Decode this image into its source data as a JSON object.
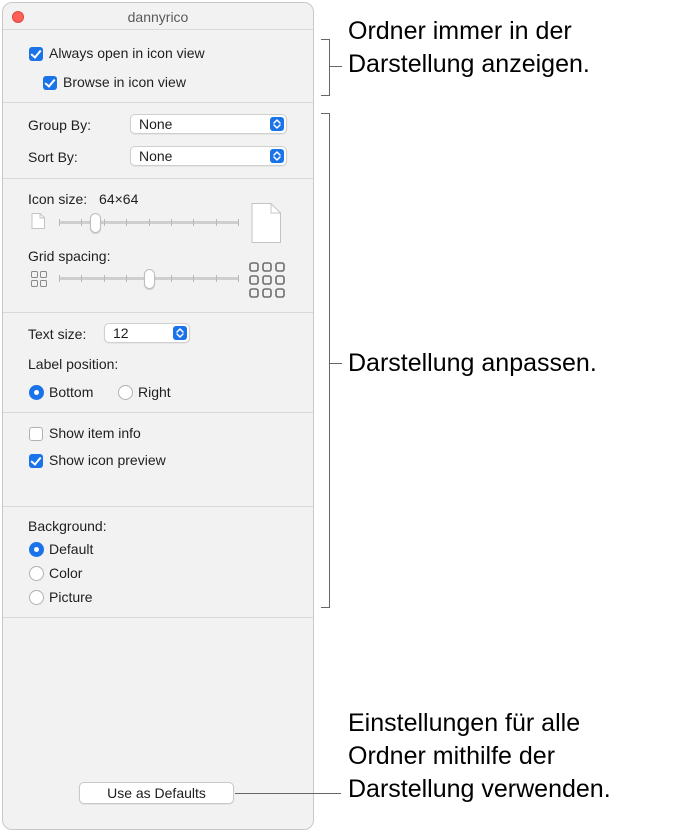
{
  "window": {
    "title": "dannyrico"
  },
  "section1": {
    "always_open_label": "Always open in icon view",
    "always_open_checked": true,
    "browse_label": "Browse in icon view",
    "browse_checked": true
  },
  "section2": {
    "group_by_label": "Group By:",
    "group_by_value": "None",
    "sort_by_label": "Sort By:",
    "sort_by_value": "None"
  },
  "section3": {
    "icon_size_label": "Icon size:",
    "icon_size_value": "64×64",
    "icon_size_slider_fraction": 0.2,
    "grid_spacing_label": "Grid spacing:",
    "grid_spacing_slider_fraction": 0.5
  },
  "section4": {
    "text_size_label": "Text size:",
    "text_size_value": "12",
    "label_position_label": "Label position:",
    "bottom_label": "Bottom",
    "right_label": "Right",
    "selected_position": "Bottom"
  },
  "section5": {
    "show_item_info_label": "Show item info",
    "show_item_info_checked": false,
    "show_icon_preview_label": "Show icon preview",
    "show_icon_preview_checked": true
  },
  "section6": {
    "background_label": "Background:",
    "options": [
      "Default",
      "Color",
      "Picture"
    ],
    "selected": "Default"
  },
  "footer": {
    "use_as_defaults_label": "Use as Defaults"
  },
  "annotations": {
    "top": [
      "Ordner immer in der",
      "Darstellung anzeigen."
    ],
    "middle": [
      "Darstellung anpassen."
    ],
    "bottom": [
      "Einstellungen für alle",
      "Ordner mithilfe der",
      "Darstellung verwenden."
    ]
  },
  "colors": {
    "accent": "#1a73e8",
    "close": "#ff5f57"
  }
}
